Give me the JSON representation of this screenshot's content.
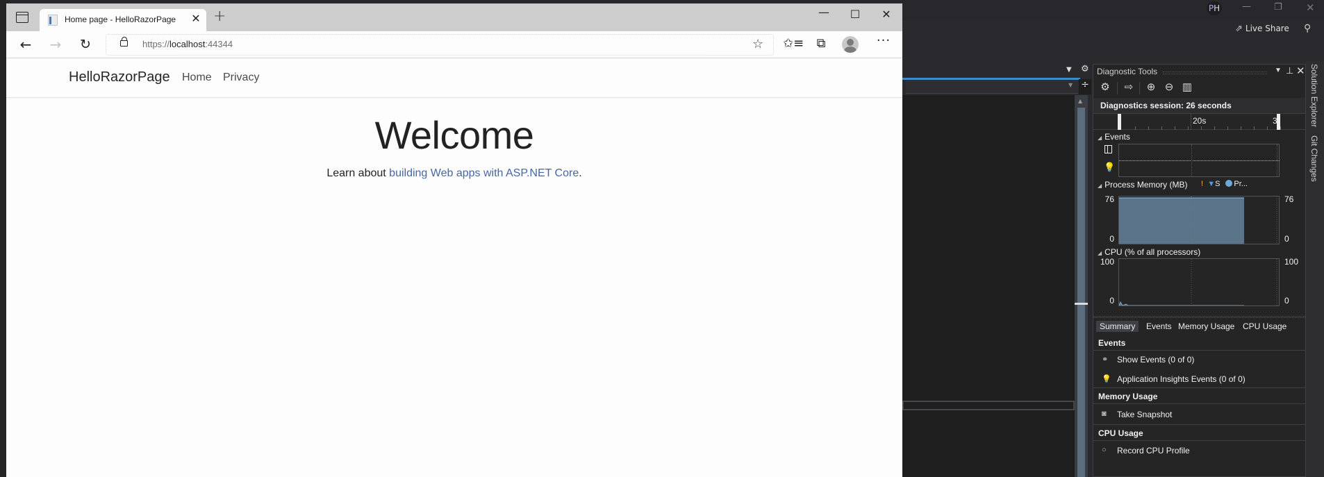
{
  "browser": {
    "tab_title": "Home page - HelloRazorPage",
    "url": {
      "scheme": "https://",
      "host": "localhost",
      "port": ":44344"
    },
    "icons": {
      "tab_actions": "tab-actions-icon",
      "close_tab": "✕",
      "new_tab": "+",
      "minimize": "—",
      "maximize": "☐",
      "close": "✕",
      "back": "←",
      "forward": "→",
      "reload": "↻",
      "add_favorite": "☆",
      "favorites": "✩≡",
      "collections": "⧉",
      "more": "···"
    }
  },
  "site": {
    "brand": "HelloRazorPage",
    "nav": [
      {
        "label": "Home"
      },
      {
        "label": "Privacy"
      }
    ],
    "heading": "Welcome",
    "learn_prefix": "Learn about ",
    "learn_link": "building Web apps with ASP.NET Core",
    "learn_suffix": "."
  },
  "vs": {
    "user_initials_1": "P",
    "user_initials_2": "H",
    "live_share": "Live Share",
    "vertical_tabs": [
      "Solution Explorer",
      "Git Changes"
    ],
    "accent_color": "#3d8bc9"
  },
  "diagnostics": {
    "title": "Diagnostic Tools",
    "session": "Diagnostics session: 26 seconds",
    "ruler_label": "20s",
    "ruler_label_cut": "3",
    "events_title": "Events",
    "memory_title": "Process Memory (MB)",
    "memory_legend": {
      "gc": "!",
      "snapshot": "S",
      "private": "Pr..."
    },
    "memory_axis": {
      "max": "76",
      "min": "0"
    },
    "memory_value_fraction": 1.0,
    "memory_fill_color": "#5b7489",
    "cpu_title": "CPU (% of all processors)",
    "cpu_axis": {
      "max": "100",
      "min": "0"
    },
    "tabs": [
      "Summary",
      "Events",
      "Memory Usage",
      "CPU Usage"
    ],
    "active_tab": "Summary",
    "summary": {
      "events_header": "Events",
      "show_events": "Show Events (0 of 0)",
      "app_insights": "Application Insights Events (0 of 0)",
      "memory_header": "Memory Usage",
      "take_snapshot": "Take Snapshot",
      "cpu_header": "CPU Usage",
      "record_cpu": "Record CPU Profile"
    }
  }
}
